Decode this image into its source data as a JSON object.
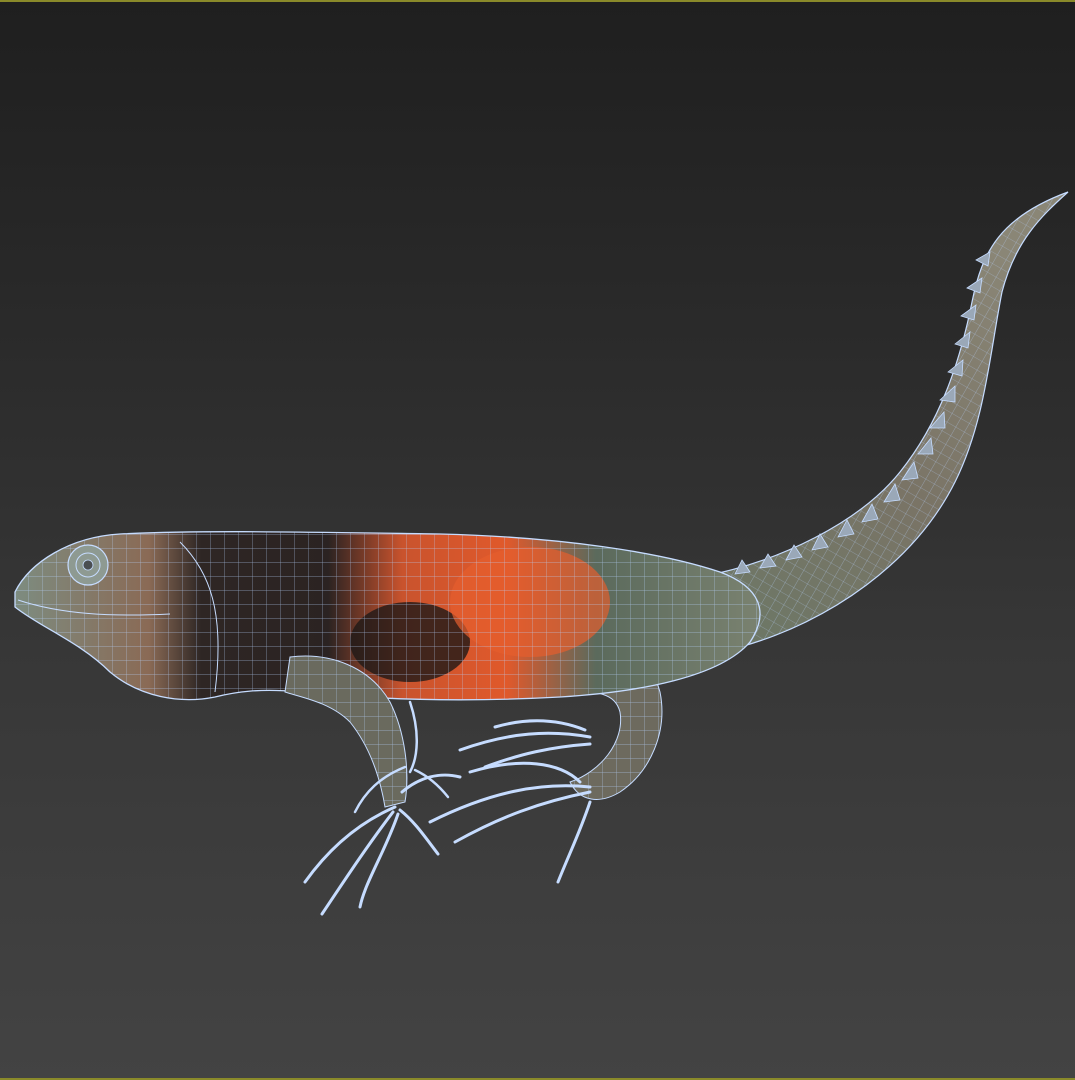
{
  "viewport": {
    "frame_color": "#8a8a2a",
    "background_top": "#1f1f1f",
    "background_bottom": "#434343",
    "shading_mode": "textured-wireframe"
  },
  "model": {
    "subject": "lizard",
    "wire_color": "#b8d4ff",
    "colors": {
      "head": "#7a8a7e",
      "back_dark": "#2b2322",
      "back_orange": "#d9542a",
      "tail": "#7a8270",
      "limbs": "#6a6a5e"
    }
  }
}
